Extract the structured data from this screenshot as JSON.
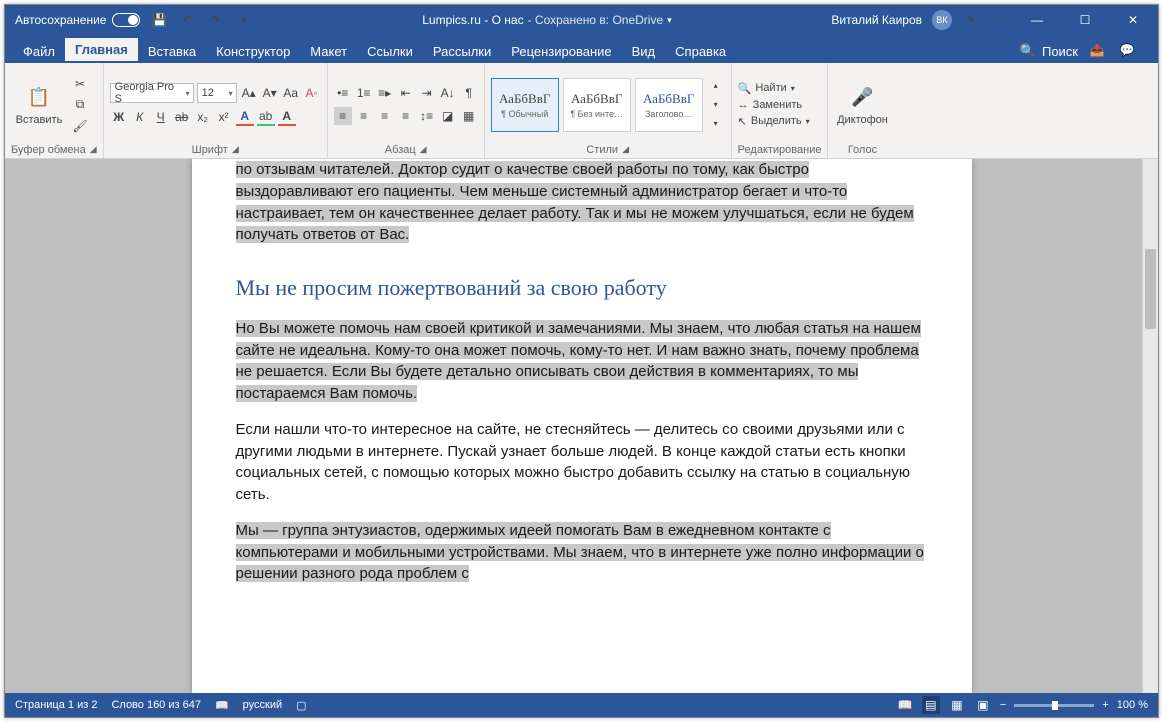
{
  "titlebar": {
    "autosave_label": "Автосохранение",
    "doc_title": "Lumpics.ru - О нас",
    "saved_label": "- Сохранено в: OneDrive",
    "user_name": "Виталий Каиров",
    "user_initials": "ВК"
  },
  "tabs": {
    "file": "Файл",
    "home": "Главная",
    "insert": "Вставка",
    "design": "Конструктор",
    "layout": "Макет",
    "references": "Ссылки",
    "mailings": "Рассылки",
    "review": "Рецензирование",
    "view": "Вид",
    "help": "Справка",
    "search": "Поиск"
  },
  "ribbon": {
    "clipboard": {
      "paste": "Вставить",
      "label": "Буфер обмена"
    },
    "font": {
      "name": "Georgia Pro S",
      "size": "12",
      "bold": "Ж",
      "italic": "К",
      "underline": "Ч",
      "label": "Шрифт"
    },
    "paragraph": {
      "label": "Абзац"
    },
    "styles": {
      "label": "Стили",
      "preview": "АаБбВвГ",
      "s1": "¶ Обычный",
      "s2": "¶ Без инте…",
      "s3": "Заголово…"
    },
    "editing": {
      "find": "Найти",
      "replace": "Заменить",
      "select": "Выделить",
      "label": "Редактирование"
    },
    "voice": {
      "dictate": "Диктофон",
      "label": "Голос"
    }
  },
  "document": {
    "p1": "по отзывам читателей. Доктор судит о качестве своей работы по тому, как быстро выздоравливают его пациенты. Чем меньше системный администратор бегает и что-то настраивает, тем он качественнее делает работу. Так и мы не можем улучшаться, если не будем получать ответов от Вас.",
    "h1": "Мы не просим пожертвований за свою работу",
    "p2": "Но Вы можете помочь нам своей критикой и замечаниями. Мы знаем, что любая статья на нашем сайте не идеальна. Кому-то она может помочь, кому-то нет. И нам важно знать, почему проблема не решается. Если Вы будете детально описывать свои действия в комментариях, то мы постараемся Вам помочь.",
    "p3": "Если нашли что-то интересное на сайте, не стесняйтесь — делитесь со своими друзьями или с другими людьми в интернете. Пускай узнает больше людей. В конце каждой статьи есть кнопки социальных сетей, с помощью которых можно быстро добавить ссылку на статью в социальную сеть.",
    "p4": "Мы — группа энтузиастов, одержимых идеей помогать Вам в ежедневном контакте с компьютерами и мобильными устройствами. Мы знаем, что в интернете уже полно информации о решении разного рода проблем с"
  },
  "statusbar": {
    "page": "Страница 1 из 2",
    "words": "Слово 160 из 647",
    "lang": "русский",
    "zoom": "100 %"
  }
}
